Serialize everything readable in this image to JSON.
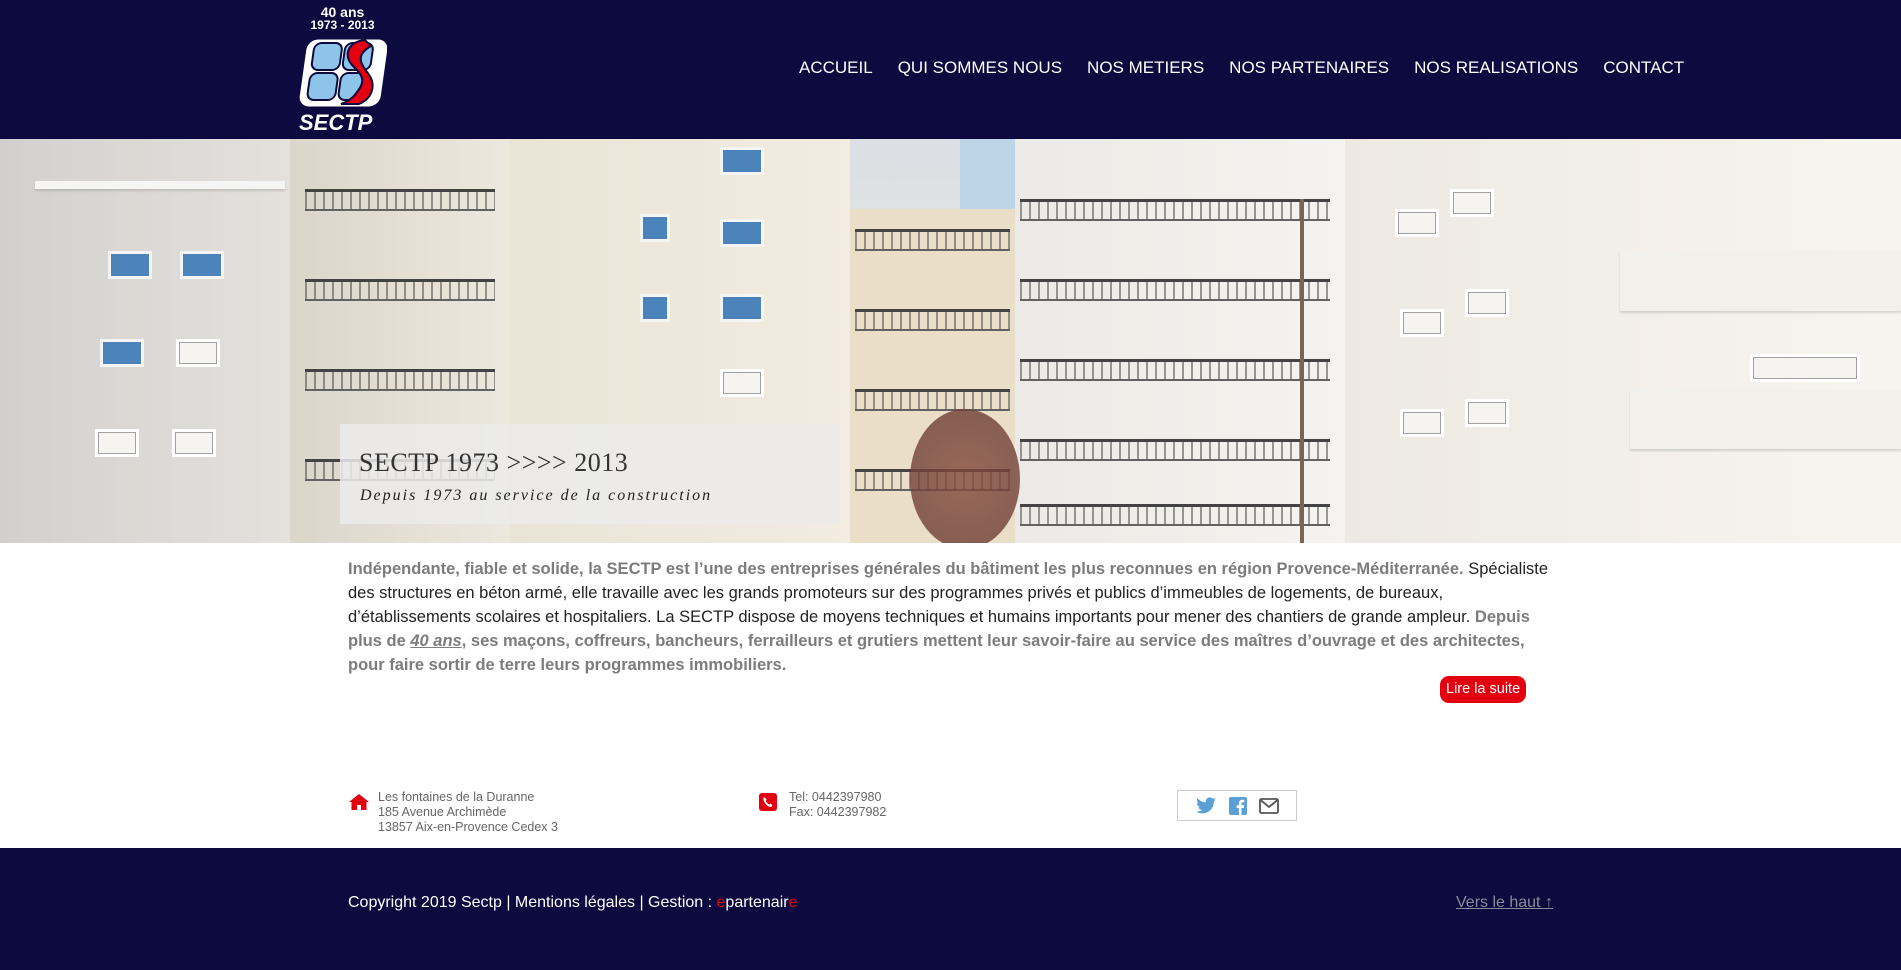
{
  "logo": {
    "years_top": "40 ans",
    "years_range": "1973 - 2013",
    "name": "SECTP"
  },
  "nav": {
    "items": [
      "ACCUEIL",
      "QUI SOMMES NOUS",
      "NOS METIERS",
      "NOS PARTENAIRES",
      "NOS REALISATIONS",
      "CONTACT"
    ]
  },
  "hero": {
    "title": "SECTP 1973 >>>> 2013",
    "subtitle": "Depuis 1973 au service de la construction"
  },
  "intro": {
    "p1": "Indépendante, fiable et solide, la SECTP est l’une des entreprises générales du bâtiment les plus reconnues en région Provence-Méditerranée.",
    "p2": " Spécialiste des structures en béton armé, elle travaille avec les grands promoteurs sur des programmes privés et publics d’immeubles de logements, de bureaux, d’établissements scolaires et hospitaliers. La SECTP dispose de moyens techniques et humains importants pour mener des chantiers de grande ampleur.",
    "p3a": " Depuis plus de ",
    "p3b": "40 ans",
    "p3c": ", ses maçons, coffreurs, bancheurs, ferrailleurs et grutiers mettent leur savoir-faire au service des maîtres d’ouvrage et des architectes, pour faire sortir de terre leurs programmes immobiliers.",
    "more_label": "Lire la suite"
  },
  "contact": {
    "address": [
      "Les fontaines de la Duranne",
      "185 Avenue Archimède",
      "13857 Aix-en-Provence Cedex 3"
    ],
    "phone": [
      "Tel: 0442397980",
      "Fax: 0442397982"
    ],
    "icons": {
      "address": "home-icon",
      "phone": "phone-icon"
    },
    "social": [
      "twitter-icon",
      "facebook-icon",
      "email-icon"
    ]
  },
  "footer": {
    "copyright": "Copyright 2019 Sectp | Mentions légales | Gestion : ",
    "brand_e1": "e",
    "brand_mid": "partenair",
    "brand_e2": "e",
    "back_to_top": "Vers le haut ↑"
  },
  "colors": {
    "navy": "#0c0a3e",
    "red": "#e3000f",
    "grey_text": "#7c7c7c"
  }
}
